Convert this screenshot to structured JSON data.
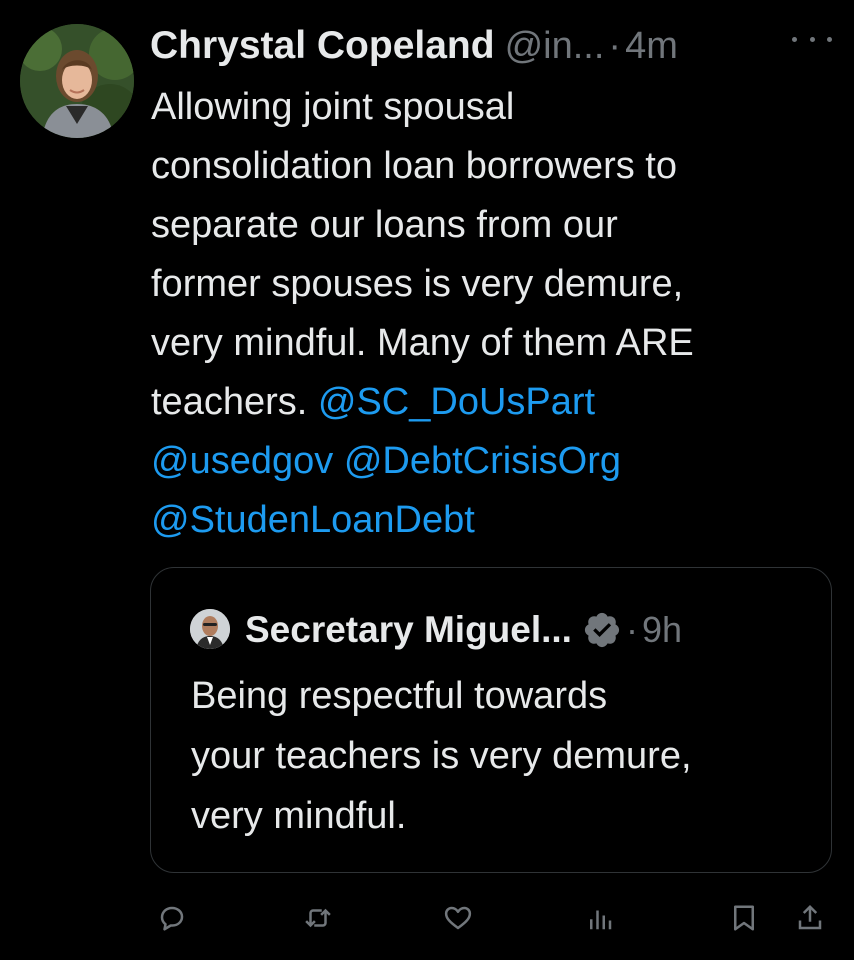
{
  "tweet": {
    "author_name": "Chrystal Copeland",
    "handle": "@in...",
    "separator": "·",
    "time": "4m",
    "more_icon": "more-horizontal-icon",
    "text_lines": [
      "Allowing joint spousal",
      "consolidation loan borrowers to",
      "separate our loans from our",
      "former spouses is very demure,",
      "very mindful. Many of them ARE"
    ],
    "last_line_prefix": "teachers. ",
    "mentions": [
      "@SC_DoUsPart",
      "@usedgov",
      "@DebtCrisisOrg",
      "@StudenLoanDebt"
    ],
    "mention_color": "#1d9bf0"
  },
  "quoted_tweet": {
    "author_name": "Secretary Miguel...",
    "verified_icon": "verified-badge-icon",
    "separator": "·",
    "time": "9h",
    "text_lines": [
      "Being respectful towards",
      "your teachers is very demure,",
      "very mindful."
    ]
  },
  "actions": {
    "reply_icon": "reply-icon",
    "retweet_icon": "retweet-icon",
    "like_icon": "heart-icon",
    "views_icon": "views-icon",
    "bookmark_icon": "bookmark-icon",
    "share_icon": "share-icon"
  }
}
